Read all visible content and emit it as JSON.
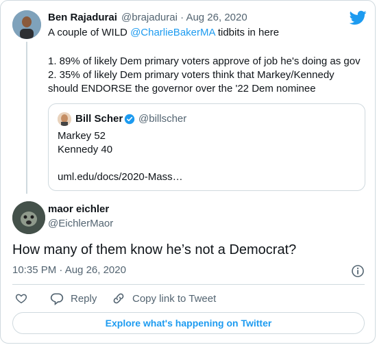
{
  "parent_tweet": {
    "author_name": "Ben Rajadurai",
    "author_handle": "@brajadurai",
    "separator": "·",
    "date": "Aug 26, 2020",
    "line1_prefix": "A couple of WILD ",
    "line1_mention": "@CharlieBakerMA",
    "line1_suffix": " tidbits in here",
    "line2": "1. 89% of likely Dem primary voters approve of job he's doing as gov",
    "line3": "2. 35% of likely Dem primary voters think that Markey/Kennedy",
    "line4": "should ENDORSE the governor over the '22 Dem nominee",
    "quoted_tweet": {
      "author_name": "Bill Scher",
      "author_handle": "@billscher",
      "line1": "Markey 52",
      "line2": "Kennedy 40",
      "link": "uml.edu/docs/2020-Mass…"
    }
  },
  "main_tweet": {
    "author_name": "maor eichler",
    "author_handle": "@EichlerMaor",
    "text": "How many of them know he’s not a Democrat?",
    "timestamp": "10:35 PM · Aug 26, 2020"
  },
  "actions": {
    "reply_label": "Reply",
    "copy_link_label": "Copy link to Tweet"
  },
  "explore_button": "Explore what's happening on Twitter",
  "colors": {
    "accent": "#1d9bf0",
    "secondary_text": "#536471",
    "border": "#cfd9de",
    "verified": "#1d9bf0"
  },
  "icons": [
    "twitter-bird-icon",
    "verified-badge-icon",
    "info-icon",
    "heart-icon",
    "reply-icon",
    "link-icon"
  ]
}
